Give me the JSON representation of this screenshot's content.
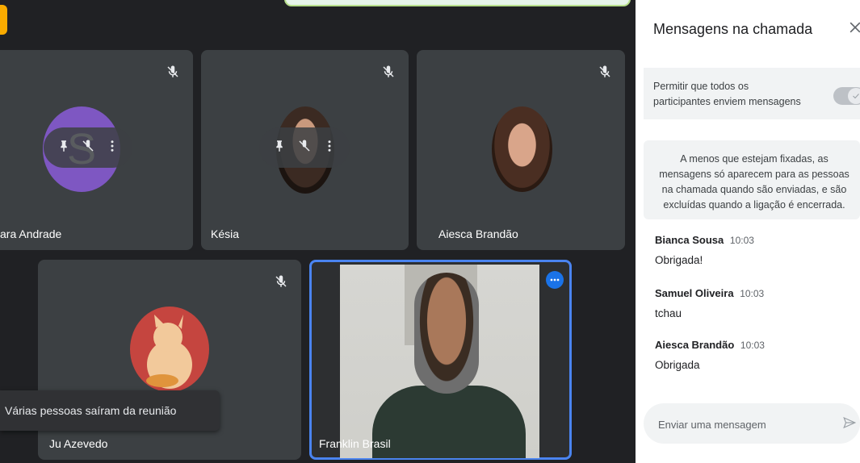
{
  "participants": {
    "tile1_name": "ara Andrade",
    "tile2_name": "Késia",
    "tile3_name": "Aiesca Brandão",
    "tile4_name": "Ju Azevedo",
    "tile5_name": "Franklin Brasil"
  },
  "toast": {
    "text": "Várias pessoas saíram da reunião"
  },
  "panel": {
    "title": "Mensagens na chamada",
    "permission_text": "Permitir que todos os participantes enviem mensagens",
    "info_text": "A menos que estejam fixadas, as mensagens só aparecem para as pessoas na chamada quando são enviadas, e são excluídas quando a ligação é encerrada.",
    "messages": [
      {
        "sender": "Bianca Sousa",
        "time": "10:03",
        "text": "Obrigada!"
      },
      {
        "sender": "Samuel Oliveira",
        "time": "10:03",
        "text": "tchau"
      },
      {
        "sender": "Aiesca Brandão",
        "time": "10:03",
        "text": "Obrigada"
      }
    ],
    "input_placeholder": "Enviar uma mensagem"
  },
  "colors": {
    "accent": "#1a73e8",
    "tile_bg": "#3c4043",
    "stage_bg": "#202124",
    "avatar_purple": "#7e57c2",
    "avatar_red": "#c5453f"
  },
  "icons": [
    "mic-off-icon",
    "pin-icon",
    "more-vert-icon",
    "more-horiz-icon",
    "close-icon",
    "send-icon",
    "check-icon"
  ]
}
